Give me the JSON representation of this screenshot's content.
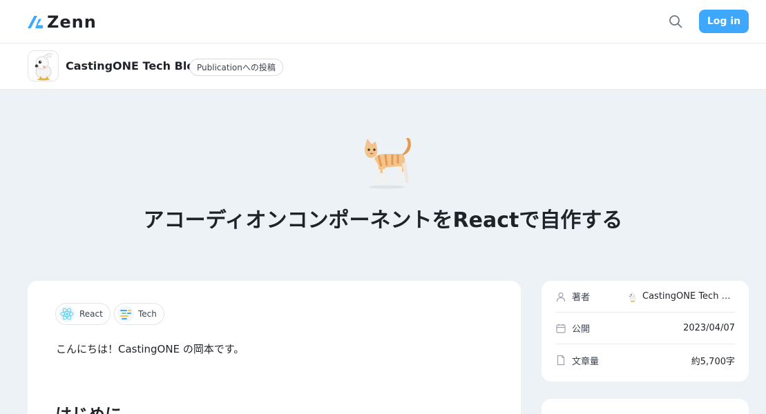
{
  "header": {
    "logo_text": "Zenn",
    "logo_color": "#3ea8ff",
    "search_icon": "search-icon",
    "login_label": "Log in",
    "login_color": "#3ea8ff"
  },
  "publication": {
    "name": "CastingONE Tech Blog",
    "badge": "Publicationへの投稿",
    "avatar_icon": "cockatoo-mascot"
  },
  "article": {
    "emoji": "🐈",
    "emoji_icon": "cat-emoji",
    "title": "アコーディオンコンポーネントをReactで自作する",
    "topics": [
      {
        "label": "React",
        "icon": "react-icon"
      },
      {
        "label": "Tech",
        "icon": "tech-icon"
      }
    ],
    "intro": "こんにちは！CastingONE の岡本です。",
    "first_heading": "はじめに"
  },
  "sidebar": {
    "author_label": "著者",
    "author_name": "CastingONE Tech Blog",
    "published_label": "公開",
    "published_date": "2023/04/07",
    "length_label": "文章量",
    "length_value": "約5,700字"
  }
}
